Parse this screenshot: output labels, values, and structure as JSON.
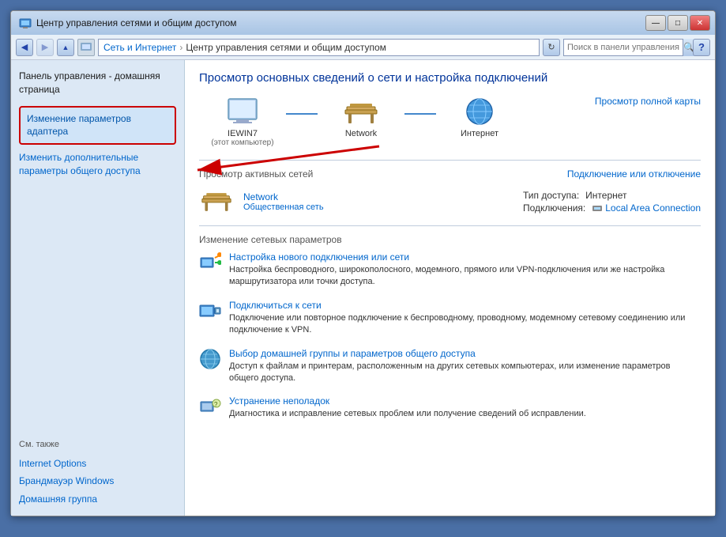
{
  "window": {
    "title": "Центр управления сетями и общим доступом",
    "controls": {
      "minimize": "—",
      "maximize": "□",
      "close": "✕"
    }
  },
  "addressbar": {
    "breadcrumb1": "Сеть и Интернет",
    "breadcrumb2": "Центр управления сетями и общим доступом",
    "search_placeholder": "Поиск в панели управления",
    "help": "?"
  },
  "sidebar": {
    "title": "Панель управления - домашняя страница",
    "highlighted_link": "Изменение параметров адаптера",
    "link2": "Изменить дополнительные параметры общего доступа",
    "also_label": "См. также",
    "also_links": [
      "Internet Options",
      "Брандмауэр Windows",
      "Домашняя группа"
    ]
  },
  "content": {
    "page_title": "Просмотр основных сведений о сети и настройка подключений",
    "map_link": "Просмотр полной карты",
    "map_items": [
      {
        "label": "IEWIN7",
        "sublabel": "(этот компьютер)"
      },
      {
        "label": "Network",
        "sublabel": ""
      },
      {
        "label": "Интернет",
        "sublabel": ""
      }
    ],
    "active_networks_header": "Просмотр активных сетей",
    "connect_link": "Подключение или отключение",
    "network_name": "Network",
    "network_type": "Общественная сеть",
    "access_type_label": "Тип доступа:",
    "access_type_value": "Интернет",
    "connections_label": "Подключения:",
    "connections_value": "Local Area Connection",
    "change_header": "Изменение сетевых параметров",
    "settings": [
      {
        "title": "Настройка нового подключения или сети",
        "desc": "Настройка беспроводного, широкополосного, модемного, прямого или VPN-подключения или же настройка маршрутизатора или точки доступа."
      },
      {
        "title": "Подключиться к сети",
        "desc": "Подключение или повторное подключение к беспроводному, проводному, модемному сетевому соединению или подключение к VPN."
      },
      {
        "title": "Выбор домашней группы и параметров общего доступа",
        "desc": "Доступ к файлам и принтерам, расположенным на других сетевых компьютерах, или изменение параметров общего доступа."
      },
      {
        "title": "Устранение неполадок",
        "desc": "Диагностика и исправление сетевых проблем или получение сведений об исправлении."
      }
    ]
  }
}
